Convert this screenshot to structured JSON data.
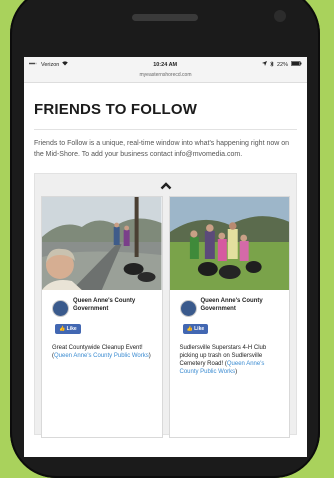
{
  "statusbar": {
    "carrier": "Verizon",
    "time": "10:24 AM",
    "battery": "22%"
  },
  "url": "myeasternshorecd.com",
  "page": {
    "title": "FRIENDS TO FOLLOW",
    "description": "Friends to Follow is a unique, real-time window into what's happening right now on the Mid-Shore. To add your business contact info@mvomedia.com."
  },
  "feed": {
    "collapse_icon": "chevron-up-icon",
    "cards": [
      {
        "name": "Queen Anne's County Government",
        "like_label": "Like",
        "post_text": "Great Countywide Cleanup Event! (",
        "post_link": "Queen Anne's County Public Works",
        "post_end": ")"
      },
      {
        "name": "Queen Anne's County Government",
        "like_label": "Like",
        "post_text": "Sudlersville Superstars 4-H Club picking up trash on Sudlersville Cemetery Road! (",
        "post_link": "Queen Anne's County Public Works",
        "post_end": ")"
      }
    ]
  },
  "colors": {
    "background": "#a9d25c",
    "like_button": "#4267b2",
    "link": "#3a8bd1"
  }
}
